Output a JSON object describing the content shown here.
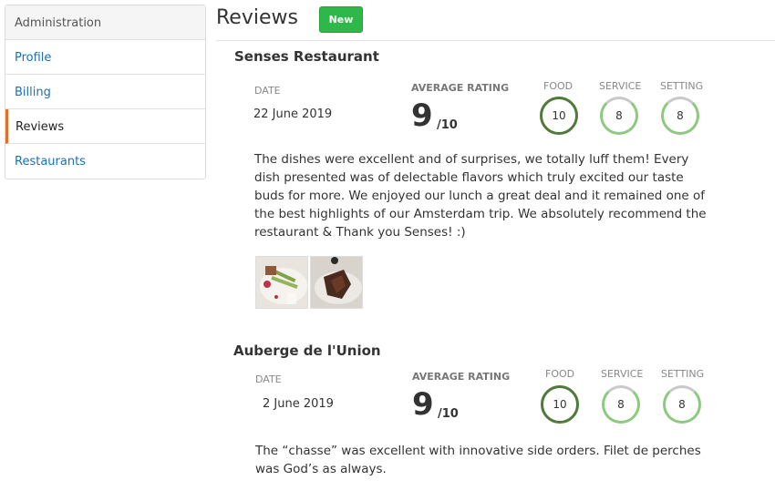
{
  "sidebar": {
    "header": "Administration",
    "items": [
      {
        "label": "Profile"
      },
      {
        "label": "Billing"
      },
      {
        "label": "Reviews"
      },
      {
        "label": "Restaurants"
      }
    ]
  },
  "header": {
    "title": "Reviews",
    "new_label": "New"
  },
  "labels": {
    "date": "DATE",
    "average_rating": "AVERAGE RATING",
    "food": "FOOD",
    "service": "SERVICE",
    "setting": "SETTING",
    "out_of": "/10"
  },
  "reviews": [
    {
      "restaurant": "Senses Restaurant",
      "date": "22 June 2019",
      "average": "9",
      "food": "10",
      "service": "8",
      "setting": "8",
      "text": "The dishes were excellent and of surprises, we totally luff them! Every dish presented was of delectable flavors which truly excited our taste buds for more. We enjoyed our lunch a great deal and it remained one of the best highlights of our Amsterdam trip. We absolutely recommend the restaurant & Thank you Senses! :)"
    },
    {
      "restaurant": "Auberge de l'Union",
      "date": "2 June 2019",
      "average": "9",
      "food": "10",
      "service": "8",
      "setting": "8",
      "text": "The “chasse” was excellent with innovative side orders. Filet de perches was God’s as always."
    }
  ],
  "colors": {
    "accent_green": "#2eb84a",
    "link_blue": "#1f6fb2",
    "active_marker": "#e0702a",
    "ring_full": "#4f7a3a",
    "ring_partial": "#8ec980"
  }
}
